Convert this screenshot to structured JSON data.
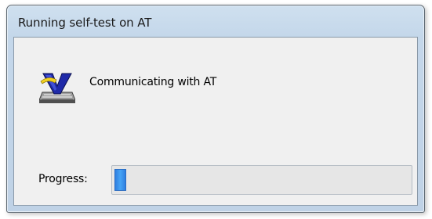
{
  "window": {
    "title": "Running self-test on AT"
  },
  "dialog": {
    "icon": "vector-v-device-icon",
    "message": "Communicating with AT"
  },
  "progress": {
    "label": "Progress:",
    "fraction": 0.04,
    "fill_color": "#3b92ec"
  }
}
